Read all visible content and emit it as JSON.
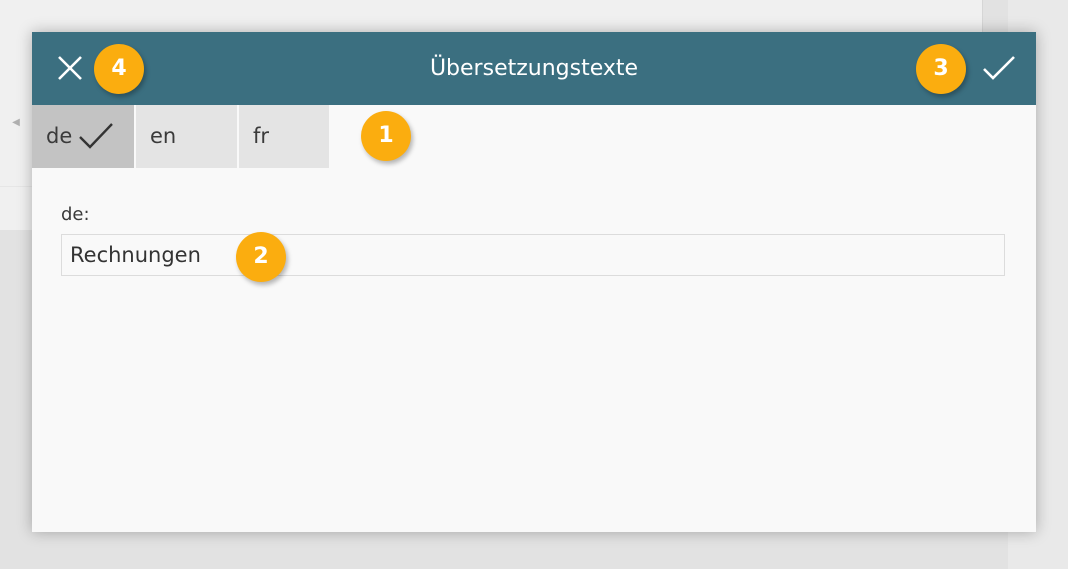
{
  "dialog": {
    "title": "Übersetzungstexte",
    "close_icon": "close-icon",
    "confirm_icon": "checkmark-icon",
    "header_color": "#3b6f80"
  },
  "tabs": [
    {
      "label": "de",
      "active": true,
      "done_icon": "checkmark-icon"
    },
    {
      "label": "en",
      "active": false
    },
    {
      "label": "fr",
      "active": false
    }
  ],
  "field": {
    "label": "de:",
    "value": "Rechnungen"
  },
  "markers": [
    "1",
    "2",
    "3",
    "4"
  ],
  "colors": {
    "marker": "#fbad0f",
    "active_tab": "#c3c3c3",
    "inactive_tab": "#e4e4e4"
  }
}
